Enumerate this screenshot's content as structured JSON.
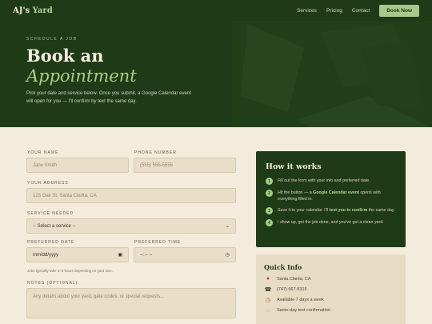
{
  "nav": {
    "logo_main": "AJ's",
    "logo_accent": "Yard",
    "links": [
      "Services",
      "Pricing",
      "Contact"
    ],
    "cta": "Book Now"
  },
  "hero": {
    "eyebrow": "SCHEDULE A JOB",
    "title_line1": "Book an",
    "title_line2": "Appointment",
    "description": "Pick your date and service below. Once you submit, a Google Calendar event will open for you — I'll confirm by text the same day."
  },
  "form": {
    "name_label": "YOUR NAME",
    "name_placeholder": "Jane Smith",
    "phone_label": "PHONE NUMBER",
    "phone_placeholder": "(555) 555-5555",
    "address_label": "YOUR ADDRESS",
    "address_placeholder": "123 Oak St, Santa Clarita, CA",
    "service_label": "SERVICE NEEDED",
    "service_value": "-- Select a service --",
    "date_label": "PREFERRED DATE",
    "date_placeholder": "mm/dd/yyyy",
    "time_label": "PREFERRED TIME",
    "time_placeholder": "--:-- --",
    "hint": "Jobs typically take 1–3 hours depending on yard size.",
    "notes_label": "NOTES (OPTIONAL)",
    "notes_placeholder": "Any details about your yard, gate codes, or special requests..."
  },
  "how": {
    "title": "How it works",
    "steps": [
      {
        "num": "1",
        "pre": "Fill out the form with your info and preferred date.",
        "bold": "",
        "post": ""
      },
      {
        "num": "2",
        "pre": "Hit the button — a ",
        "bold": "Google Calendar event",
        "post": " opens with everything filled in."
      },
      {
        "num": "3",
        "pre": "Save it to your calendar. I'll ",
        "bold": "text you to confirm",
        "post": " the same day."
      },
      {
        "num": "4",
        "pre": "I show up, get the job done, and you've got a clean yard.",
        "bold": "",
        "post": ""
      }
    ]
  },
  "quick": {
    "title": "Quick Info",
    "items": [
      {
        "icon": "map-pin-icon",
        "text": "Santa Clarita, CA"
      },
      {
        "icon": "phone-icon",
        "text": "(747) 667-5315"
      },
      {
        "icon": "clock-icon",
        "text": "Available 7 days a week"
      },
      {
        "icon": "chat-icon",
        "text": "Same-day text confirmation"
      }
    ]
  },
  "colors": {
    "brand_dark": "#1f3a17",
    "accent_green": "#a9cf86",
    "cream": "#f3ecdc"
  }
}
